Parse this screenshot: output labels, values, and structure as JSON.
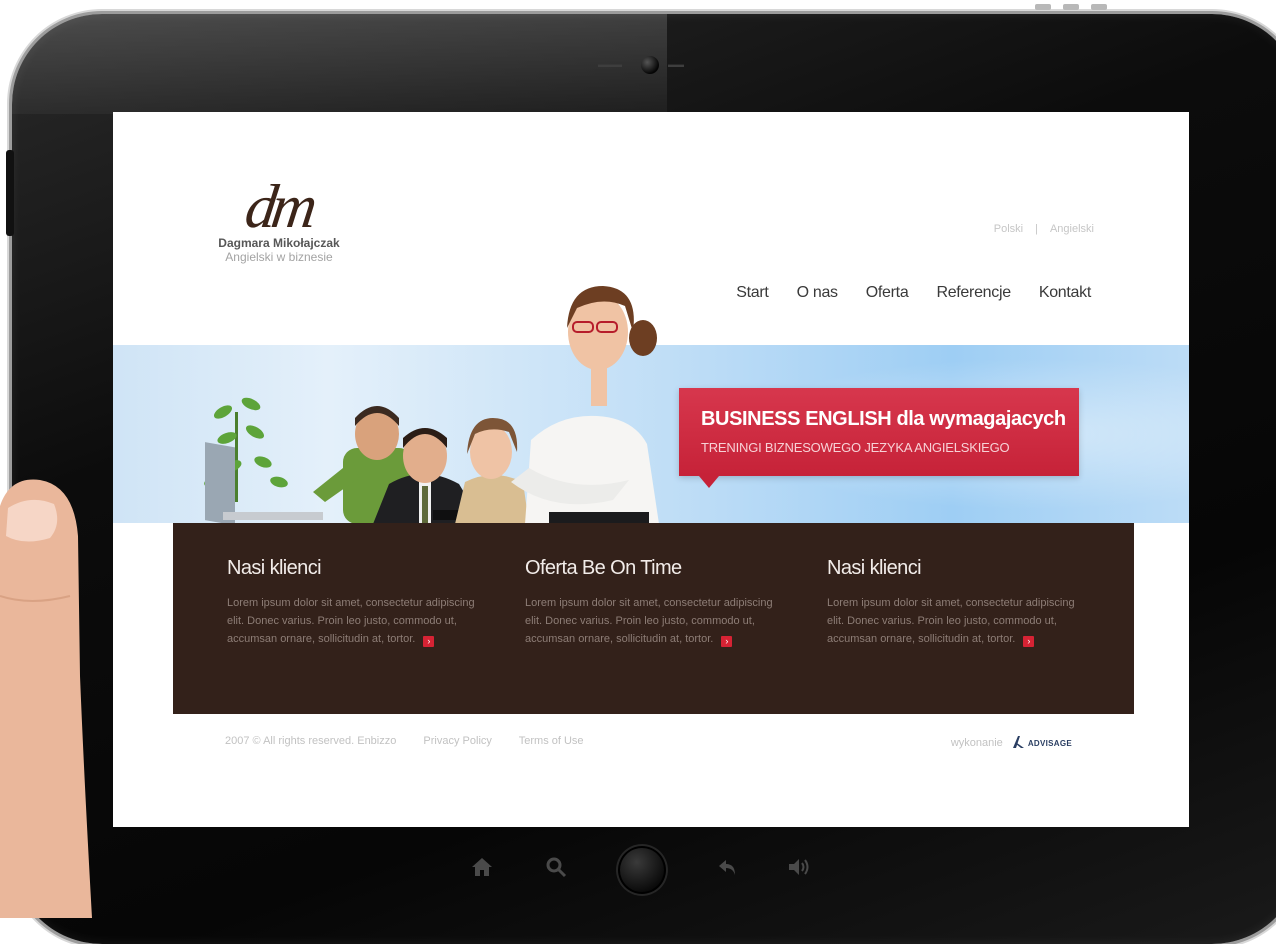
{
  "site": {
    "logo": {
      "mark": "dm",
      "name": "Dagmara Mikołajczak",
      "tagline": "Angielski w biznesie"
    },
    "languages": [
      "Polski",
      "|",
      "Angielski"
    ],
    "nav": [
      "Start",
      "O nas",
      "Oferta",
      "Referencje",
      "Kontakt"
    ],
    "promo": {
      "title": "BUSINESS ENGLISH dla wymagajacych",
      "subtitle": "TRENINGI BIZNESOWEGO JEZYKA ANGIELSKIEGO"
    },
    "features": [
      {
        "title": "Nasi klienci",
        "text": "Lorem ipsum dolor sit amet, consectetur adipiscing elit. Donec varius. Proin leo justo, commodo ut, accumsan ornare, sollicitudin at, tortor."
      },
      {
        "title": "Oferta Be On Time",
        "text": "Lorem ipsum dolor sit amet, consectetur adipiscing elit. Donec varius. Proin leo justo, commodo ut, accumsan ornare, sollicitudin at, tortor."
      },
      {
        "title": "Nasi klienci",
        "text": "Lorem ipsum dolor sit amet, consectetur adipiscing elit. Donec varius. Proin leo justo, commodo ut, accumsan ornare, sollicitudin at, tortor."
      }
    ],
    "footer": {
      "copyright": "2007 © All rights reserved. Enbizzo",
      "privacy": "Privacy Policy",
      "terms": "Terms of Use",
      "credit_label": "wykonanie",
      "credit_brand": "ADVISAGE"
    }
  },
  "device": {
    "buttons": [
      "home-icon",
      "search-icon",
      "home-button",
      "back-icon",
      "volume-icon"
    ]
  },
  "colors": {
    "promo_red": "#c62238",
    "panel_brown": "#33211a",
    "more_red": "#d62334",
    "banner_blue": "#9ecef4"
  }
}
